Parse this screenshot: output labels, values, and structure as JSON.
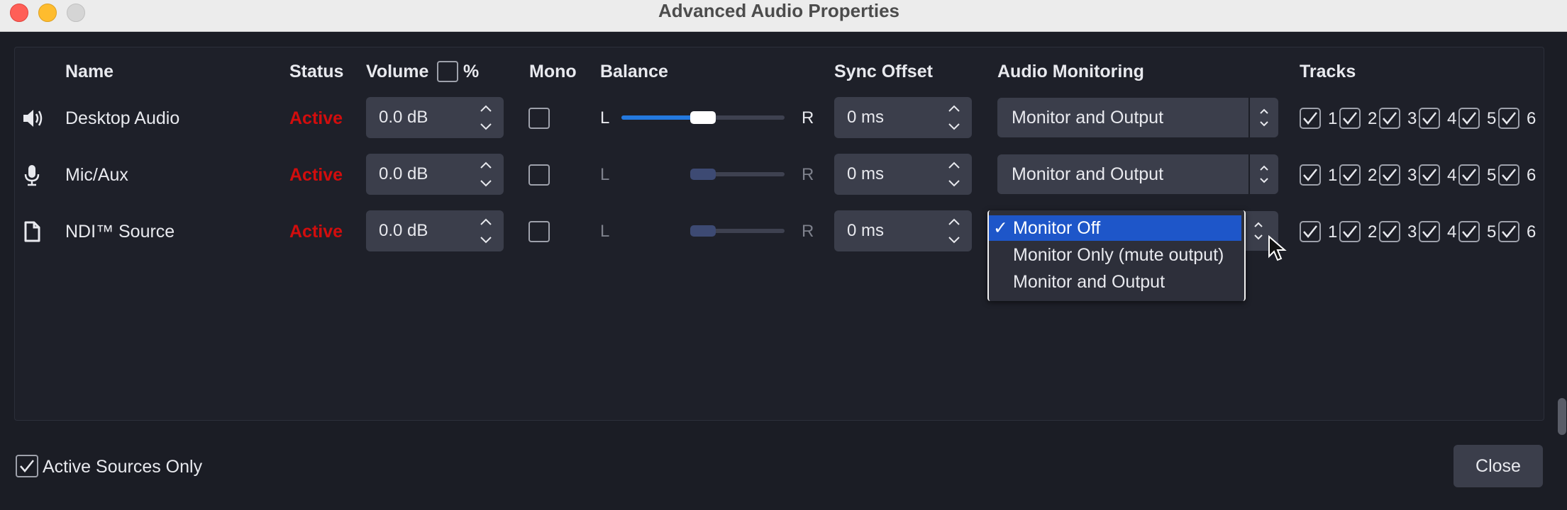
{
  "window": {
    "title": "Advanced Audio Properties"
  },
  "headers": {
    "name": "Name",
    "status": "Status",
    "volume": "Volume",
    "volume_percent": "%",
    "mono": "Mono",
    "balance": "Balance",
    "sync_offset": "Sync Offset",
    "audio_monitoring": "Audio Monitoring",
    "tracks": "Tracks"
  },
  "balance_labels": {
    "left": "L",
    "right": "R"
  },
  "track_numbers": [
    "1",
    "2",
    "3",
    "4",
    "5",
    "6"
  ],
  "rows": [
    {
      "name": "Desktop Audio",
      "icon": "speaker-icon",
      "status": "Active",
      "volume": "0.0 dB",
      "mono": false,
      "balance": 0.5,
      "balance_enabled": true,
      "sync_offset": "0 ms",
      "monitoring": "Monitor and Output"
    },
    {
      "name": "Mic/Aux",
      "icon": "microphone-icon",
      "status": "Active",
      "volume": "0.0 dB",
      "mono": false,
      "balance": 0.5,
      "balance_enabled": false,
      "sync_offset": "0 ms",
      "monitoring": "Monitor and Output"
    },
    {
      "name": "NDI™ Source",
      "icon": "document-icon",
      "status": "Active",
      "volume": "0.0 dB",
      "mono": false,
      "balance": 0.5,
      "balance_enabled": false,
      "sync_offset": "0 ms",
      "monitoring": "Monitor Off"
    }
  ],
  "monitoring_dropdown": {
    "check_mark": "✓",
    "options": [
      "Monitor Off",
      "Monitor Only (mute output)",
      "Monitor and Output"
    ],
    "selected_index": 0
  },
  "footer": {
    "active_sources_only": "Active Sources Only",
    "close": "Close"
  },
  "colors": {
    "status_active": "#d20d0d",
    "accent": "#2479df",
    "selected_option": "#1e56c9"
  }
}
